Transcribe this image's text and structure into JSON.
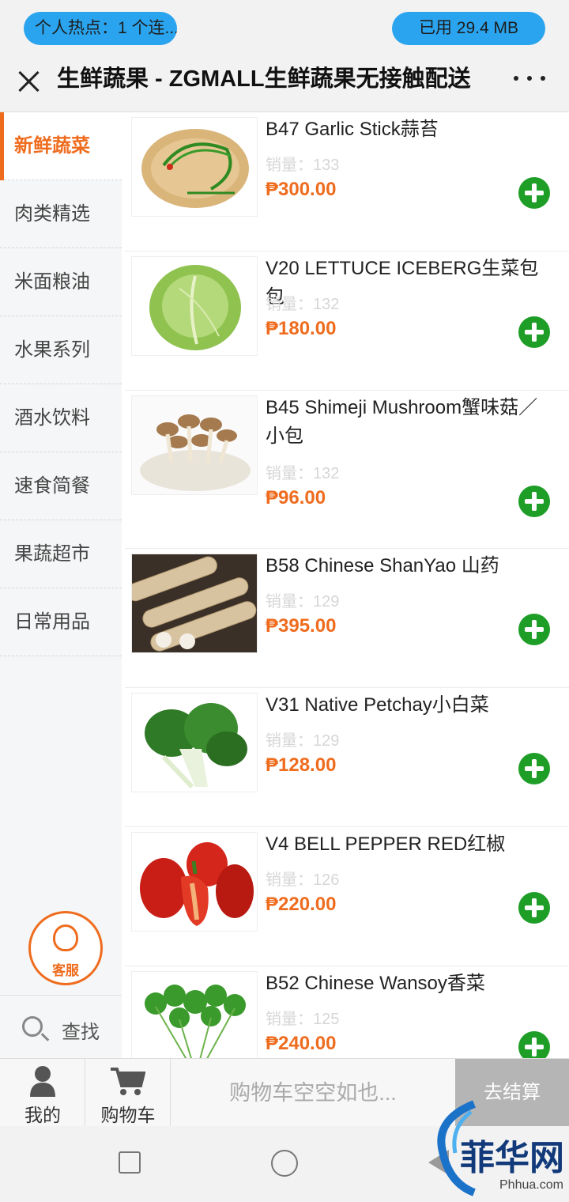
{
  "status_bar": {
    "hotspot": "个人热点：1 个连...",
    "data_used": "已用 29.4 MB"
  },
  "header": {
    "title": "生鲜蔬果 - ZGMALL生鲜蔬果无接触配送"
  },
  "sidebar": {
    "categories": [
      {
        "label": "新鲜蔬菜"
      },
      {
        "label": "肉类精选"
      },
      {
        "label": "米面粮油"
      },
      {
        "label": "水果系列"
      },
      {
        "label": "酒水饮料"
      },
      {
        "label": "速食简餐"
      },
      {
        "label": "果蔬超市"
      },
      {
        "label": "日常用品"
      }
    ],
    "customer_service": "客服",
    "search": "查找"
  },
  "products": [
    {
      "name": "B47 Garlic Stick蒜苔",
      "sales": "销量：133",
      "price": "₱300.00"
    },
    {
      "name": "V20 LETTUCE ICEBERG生菜包包",
      "sales": "销量：132",
      "price": "₱180.00"
    },
    {
      "name": "B45 Shimeji Mushroom蟹味菇／小包",
      "sales": "销量：132",
      "price": "₱96.00"
    },
    {
      "name": "B58 Chinese ShanYao 山药",
      "sales": "销量：129",
      "price": "₱395.00"
    },
    {
      "name": "V31 Native Petchay小白菜",
      "sales": "销量：129",
      "price": "₱128.00"
    },
    {
      "name": "V4 BELL PEPPER RED红椒",
      "sales": "销量：126",
      "price": "₱220.00"
    },
    {
      "name": "B52 Chinese Wansoy香菜",
      "sales": "销量：125",
      "price": "₱240.00"
    }
  ],
  "bottom_bar": {
    "mine": "我的",
    "cart": "购物车",
    "cart_empty": "购物车空空如也...",
    "checkout": "去结算"
  },
  "watermark": {
    "text": "菲华网",
    "url": "Phhua.com"
  },
  "colors": {
    "accent": "#ef6c1e",
    "add_button": "#1e9e27",
    "pill": "#2aa4ee"
  }
}
